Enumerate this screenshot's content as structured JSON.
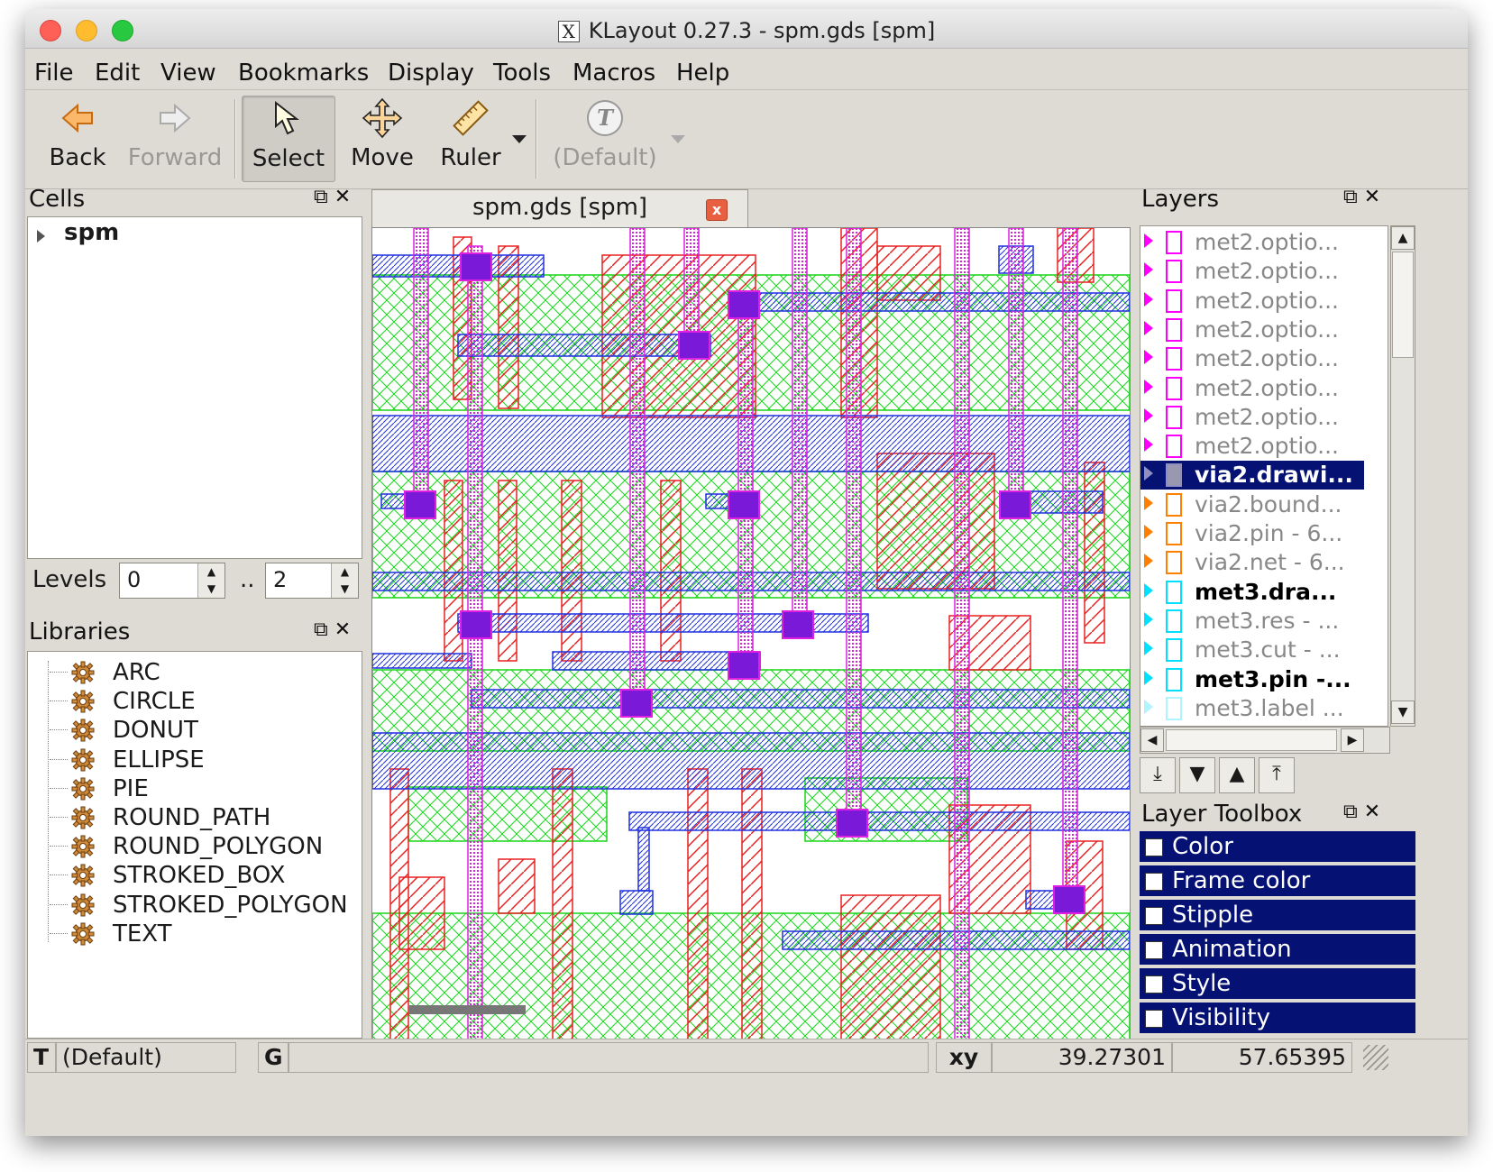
{
  "window": {
    "title": "KLayout 0.27.3 - spm.gds [spm]",
    "x_icon": "X"
  },
  "menu": {
    "file": "File",
    "edit": "Edit",
    "view": "View",
    "bookmarks": "Bookmarks",
    "display": "Display",
    "tools": "Tools",
    "macros": "Macros",
    "help": "Help"
  },
  "toolbar": {
    "back": "Back",
    "forward": "Forward",
    "select": "Select",
    "move": "Move",
    "ruler": "Ruler",
    "default": "(Default)"
  },
  "cells": {
    "title": "Cells",
    "root": "spm",
    "levels_label": "Levels",
    "levels_from": "0",
    "levels_sep": "..",
    "levels_to": "2"
  },
  "libraries": {
    "title": "Libraries",
    "items": [
      "ARC",
      "CIRCLE",
      "DONUT",
      "ELLIPSE",
      "PIE",
      "ROUND_PATH",
      "ROUND_POLYGON",
      "STROKED_BOX",
      "STROKED_POLYGON",
      "TEXT"
    ]
  },
  "tab": {
    "label": "spm.gds [spm]",
    "close": "x"
  },
  "layers": {
    "title": "Layers",
    "items": [
      {
        "name": "met2.optio...",
        "color": "#ff00ff",
        "style": "normal"
      },
      {
        "name": "met2.optio...",
        "color": "#ff00ff",
        "style": "normal"
      },
      {
        "name": "met2.optio...",
        "color": "#ff00ff",
        "style": "normal"
      },
      {
        "name": "met2.optio...",
        "color": "#ff00ff",
        "style": "normal"
      },
      {
        "name": "met2.optio...",
        "color": "#ff00ff",
        "style": "normal"
      },
      {
        "name": "met2.optio...",
        "color": "#ff00ff",
        "style": "normal"
      },
      {
        "name": "met2.optio...",
        "color": "#ff00ff",
        "style": "normal"
      },
      {
        "name": "met2.optio...",
        "color": "#ff00ff",
        "style": "normal"
      },
      {
        "name": "via2.drawi...",
        "color": "#9090c0",
        "style": "selected"
      },
      {
        "name": "via2.bound...",
        "color": "#ff8000",
        "style": "normal"
      },
      {
        "name": "via2.pin - 6...",
        "color": "#ff8000",
        "style": "normal"
      },
      {
        "name": "via2.net - 6...",
        "color": "#ff8000",
        "style": "normal"
      },
      {
        "name": "met3.dra...",
        "color": "#00e0ff",
        "style": "bold"
      },
      {
        "name": "met3.res - ...",
        "color": "#00e0ff",
        "style": "normal"
      },
      {
        "name": "met3.cut - ...",
        "color": "#00e0ff",
        "style": "normal"
      },
      {
        "name": "met3.pin -...",
        "color": "#00e0ff",
        "style": "bold"
      },
      {
        "name": "met3.label ...",
        "color": "#b0f4ff",
        "style": "normal"
      }
    ]
  },
  "layer_toolbox": {
    "title": "Layer Toolbox",
    "items": [
      "Color",
      "Frame color",
      "Stipple",
      "Animation",
      "Style",
      "Visibility"
    ]
  },
  "status": {
    "text_label": "T",
    "text_value": "(Default)",
    "grid_label": "G",
    "xy_label": "xy",
    "x": "39.27301",
    "y": "57.65395"
  }
}
